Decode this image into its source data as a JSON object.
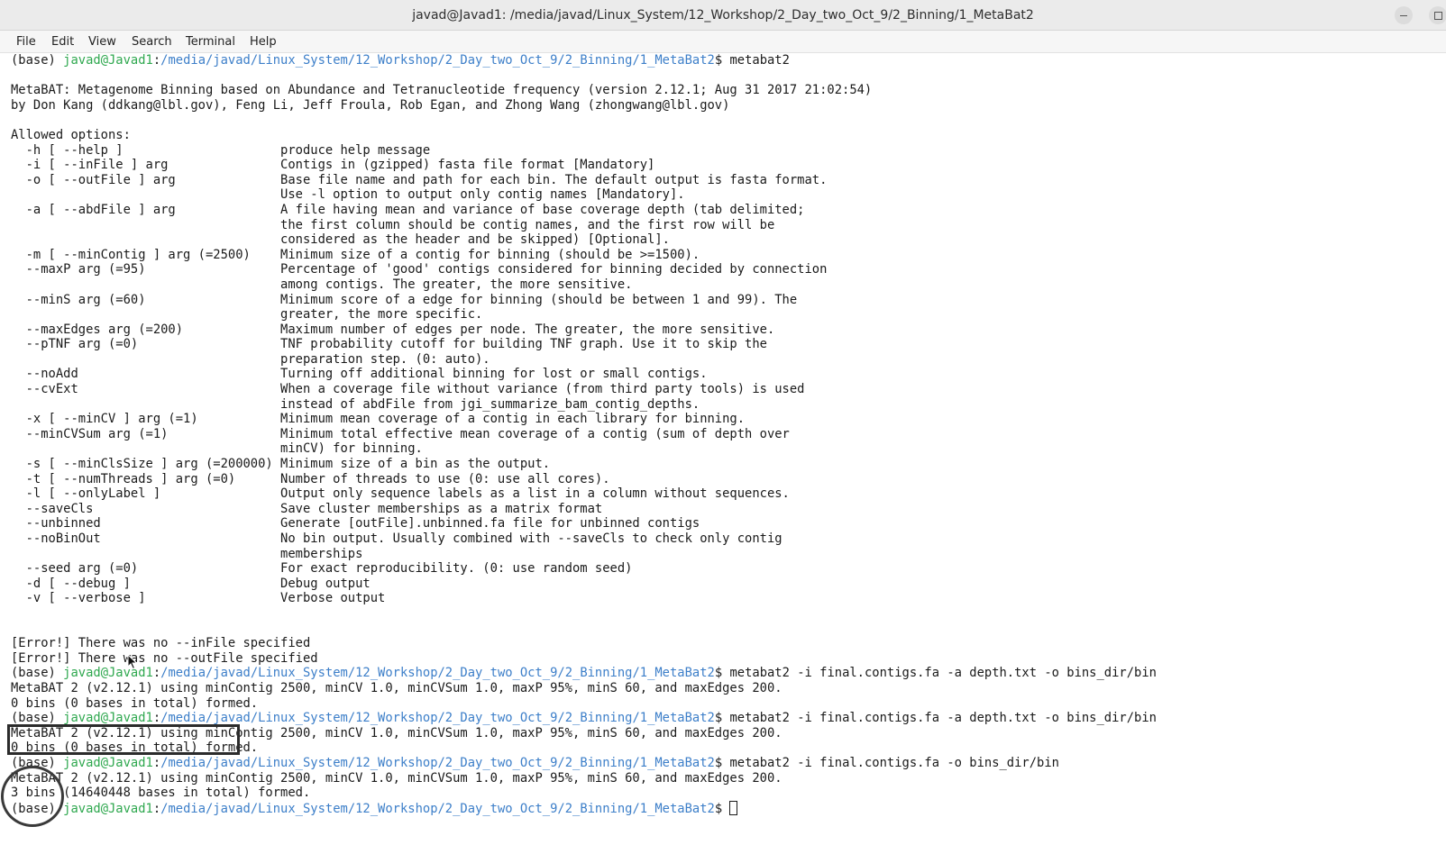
{
  "window": {
    "title": "javad@Javad1: /media/javad/Linux_System/12_Workshop/2_Day_two_Oct_9/2_Binning/1_MetaBat2"
  },
  "menu": [
    "File",
    "Edit",
    "View",
    "Search",
    "Terminal",
    "Help"
  ],
  "prompt": {
    "env": "(base) ",
    "user_host": "javad@Javad1",
    "sep": ":",
    "path": "/media/javad/Linux_System/12_Workshop/2_Day_two_Oct_9/2_Binning/1_MetaBat2",
    "symbol": "$ "
  },
  "lines": [
    {
      "type": "prompt",
      "cmd": "metabat2"
    },
    {
      "type": "text",
      "text": ""
    },
    {
      "type": "text",
      "text": "MetaBAT: Metagenome Binning based on Abundance and Tetranucleotide frequency (version 2.12.1; Aug 31 2017 21:02:54)"
    },
    {
      "type": "text",
      "text": "by Don Kang (ddkang@lbl.gov), Feng Li, Jeff Froula, Rob Egan, and Zhong Wang (zhongwang@lbl.gov)"
    },
    {
      "type": "text",
      "text": ""
    },
    {
      "type": "text",
      "text": "Allowed options:"
    },
    {
      "type": "text",
      "text": "  -h [ --help ]                     produce help message"
    },
    {
      "type": "text",
      "text": "  -i [ --inFile ] arg               Contigs in (gzipped) fasta file format [Mandatory]"
    },
    {
      "type": "text",
      "text": "  -o [ --outFile ] arg              Base file name and path for each bin. The default output is fasta format."
    },
    {
      "type": "text",
      "text": "                                    Use -l option to output only contig names [Mandatory]."
    },
    {
      "type": "text",
      "text": "  -a [ --abdFile ] arg              A file having mean and variance of base coverage depth (tab delimited;"
    },
    {
      "type": "text",
      "text": "                                    the first column should be contig names, and the first row will be"
    },
    {
      "type": "text",
      "text": "                                    considered as the header and be skipped) [Optional]."
    },
    {
      "type": "text",
      "text": "  -m [ --minContig ] arg (=2500)    Minimum size of a contig for binning (should be >=1500)."
    },
    {
      "type": "text",
      "text": "  --maxP arg (=95)                  Percentage of 'good' contigs considered for binning decided by connection"
    },
    {
      "type": "text",
      "text": "                                    among contigs. The greater, the more sensitive."
    },
    {
      "type": "text",
      "text": "  --minS arg (=60)                  Minimum score of a edge for binning (should be between 1 and 99). The"
    },
    {
      "type": "text",
      "text": "                                    greater, the more specific."
    },
    {
      "type": "text",
      "text": "  --maxEdges arg (=200)             Maximum number of edges per node. The greater, the more sensitive."
    },
    {
      "type": "text",
      "text": "  --pTNF arg (=0)                   TNF probability cutoff for building TNF graph. Use it to skip the"
    },
    {
      "type": "text",
      "text": "                                    preparation step. (0: auto)."
    },
    {
      "type": "text",
      "text": "  --noAdd                           Turning off additional binning for lost or small contigs."
    },
    {
      "type": "text",
      "text": "  --cvExt                           When a coverage file without variance (from third party tools) is used"
    },
    {
      "type": "text",
      "text": "                                    instead of abdFile from jgi_summarize_bam_contig_depths."
    },
    {
      "type": "text",
      "text": "  -x [ --minCV ] arg (=1)           Minimum mean coverage of a contig in each library for binning."
    },
    {
      "type": "text",
      "text": "  --minCVSum arg (=1)               Minimum total effective mean coverage of a contig (sum of depth over"
    },
    {
      "type": "text",
      "text": "                                    minCV) for binning."
    },
    {
      "type": "text",
      "text": "  -s [ --minClsSize ] arg (=200000) Minimum size of a bin as the output."
    },
    {
      "type": "text",
      "text": "  -t [ --numThreads ] arg (=0)      Number of threads to use (0: use all cores)."
    },
    {
      "type": "text",
      "text": "  -l [ --onlyLabel ]                Output only sequence labels as a list in a column without sequences."
    },
    {
      "type": "text",
      "text": "  --saveCls                         Save cluster memberships as a matrix format"
    },
    {
      "type": "text",
      "text": "  --unbinned                        Generate [outFile].unbinned.fa file for unbinned contigs"
    },
    {
      "type": "text",
      "text": "  --noBinOut                        No bin output. Usually combined with --saveCls to check only contig"
    },
    {
      "type": "text",
      "text": "                                    memberships"
    },
    {
      "type": "text",
      "text": "  --seed arg (=0)                   For exact reproducibility. (0: use random seed)"
    },
    {
      "type": "text",
      "text": "  -d [ --debug ]                    Debug output"
    },
    {
      "type": "text",
      "text": "  -v [ --verbose ]                  Verbose output"
    },
    {
      "type": "text",
      "text": ""
    },
    {
      "type": "text",
      "text": ""
    },
    {
      "type": "text",
      "text": "[Error!] There was no --inFile specified"
    },
    {
      "type": "text",
      "text": "[Error!] There was no --outFile specified"
    },
    {
      "type": "prompt",
      "cmd": "metabat2 -i final.contigs.fa -a depth.txt -o bins_dir/bin"
    },
    {
      "type": "text",
      "text": "MetaBAT 2 (v2.12.1) using minContig 2500, minCV 1.0, minCVSum 1.0, maxP 95%, minS 60, and maxEdges 200."
    },
    {
      "type": "text",
      "text": "0 bins (0 bases in total) formed."
    },
    {
      "type": "prompt",
      "cmd": "metabat2 -i final.contigs.fa -a depth.txt -o bins_dir/bin"
    },
    {
      "type": "text",
      "text": "MetaBAT 2 (v2.12.1) using minContig 2500, minCV 1.0, minCVSum 1.0, maxP 95%, minS 60, and maxEdges 200."
    },
    {
      "type": "text",
      "text": "0 bins (0 bases in total) formed."
    },
    {
      "type": "prompt",
      "cmd": "metabat2 -i final.contigs.fa -o bins_dir/bin"
    },
    {
      "type": "text",
      "text": "MetaBAT 2 (v2.12.1) using minContig 2500, minCV 1.0, minCVSum 1.0, maxP 95%, minS 60, and maxEdges 200."
    },
    {
      "type": "text",
      "text": "3 bins (14640448 bases in total) formed."
    },
    {
      "type": "prompt",
      "cmd": "",
      "cursor": true
    }
  ]
}
